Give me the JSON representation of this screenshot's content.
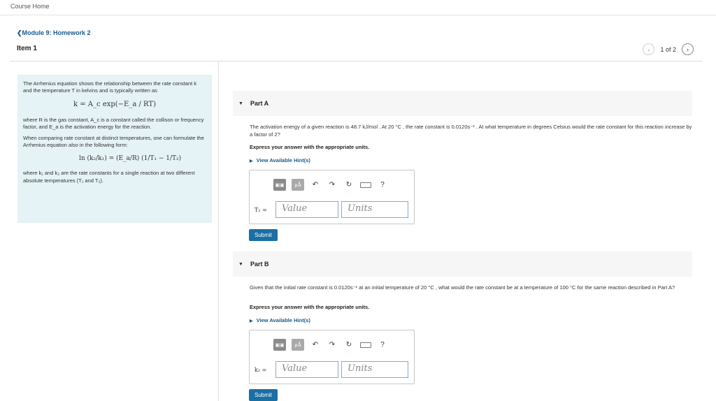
{
  "nav": {
    "course_home": "Course Home",
    "back_link": "❮Module 9: Homework 2",
    "item_title": "Item 1"
  },
  "pager": {
    "prev": "‹",
    "text": "1 of 2",
    "next": "›"
  },
  "intro": {
    "p1": "The Arrhenius equation shows the relationship between the rate constant k and the temperature T in kelvins and is typically written as",
    "eq1": "k = A_c exp(−E_a / RT)",
    "p2": "where R is the gas constant, A_c is a constant called the collison or frequency factor, and E_a is the activation energy for the reaction.",
    "p3": "When comparing rate constant at distinct temperatures, one can formulate the Arrhenius equation also in the following form:",
    "eq2": "ln (k₂/k₁) = (E_a/R) (1/T₁ − 1/T₂)",
    "p4": "where k₁ and k₂ are the rate constants for a single reaction at two different absolute temperatures (T₁ and T₂)."
  },
  "parts": [
    {
      "label": "Part A",
      "question": "The activation energy of a given reaction is 48.7 kJ/mol . At 20 °C , the rate constant is 0.0120s⁻¹ . At what temperature in degrees Celsius would the rate constant for this reaction increase by a factor of 2?",
      "instruction": "Express your answer with the appropriate units.",
      "hint": "View Available Hint(s)",
      "variable": "T₂ =",
      "value_placeholder": "Value",
      "units_placeholder": "Units",
      "submit": "Submit"
    },
    {
      "label": "Part B",
      "question": "Given that the initial rate constant is 0.0120s⁻¹ at an initial temperature of 20 °C , what would the rate constant be at a temperature of 100 °C for the same reaction described in Part A?",
      "instruction": "Express your answer with the appropriate units.",
      "hint": "View Available Hint(s)",
      "variable": "k₂ =",
      "value_placeholder": "Value",
      "units_placeholder": "Units",
      "submit": "Submit"
    }
  ],
  "toolbar": {
    "templates_icon": "template-icon",
    "mu_label": "μÅ",
    "undo_icon": "undo-icon",
    "redo_icon": "redo-icon",
    "reset_icon": "reset-icon",
    "keyboard_icon": "keyboard-icon",
    "help_label": "?"
  }
}
